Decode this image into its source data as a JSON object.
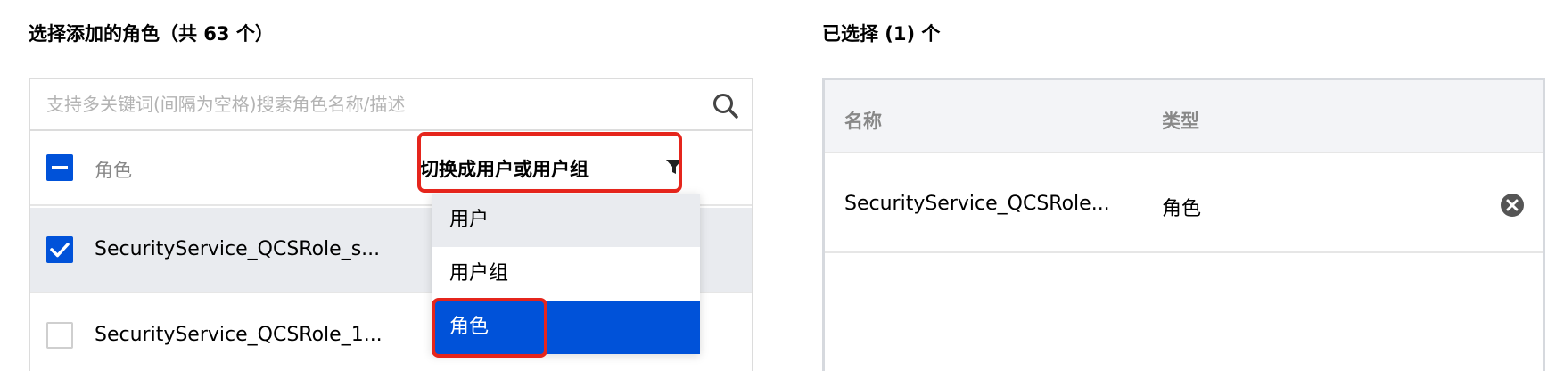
{
  "left": {
    "title": "选择添加的角色（共 63 个）",
    "search_placeholder": "支持多关键词(间隔为空格)搜索角色名称/描述",
    "column_role": "角色",
    "switch_label": "切换成用户或用户组",
    "rows": [
      {
        "name": "SecurityService_QCSRole_s...",
        "checked": true
      },
      {
        "name": "SecurityService_QCSRole_1...",
        "checked": false
      }
    ]
  },
  "dropdown": {
    "items": [
      {
        "label": "用户",
        "state": "hover"
      },
      {
        "label": "用户组",
        "state": "normal"
      },
      {
        "label": "角色",
        "state": "selected"
      }
    ]
  },
  "right": {
    "title": "已选择 (1) 个",
    "column_name": "名称",
    "column_type": "类型",
    "rows": [
      {
        "name": "SecurityService_QCSRole...",
        "type": "角色"
      }
    ]
  },
  "colors": {
    "accent": "#0052d9",
    "highlight": "#e5251c",
    "row_hover": "#e9ebef"
  },
  "icons": {
    "search": "search-icon",
    "filter": "filter-icon",
    "remove": "remove-icon",
    "checkbox_indeterminate": "checkbox-indeterminate-icon",
    "checkbox_checked": "checkbox-checked-icon"
  }
}
